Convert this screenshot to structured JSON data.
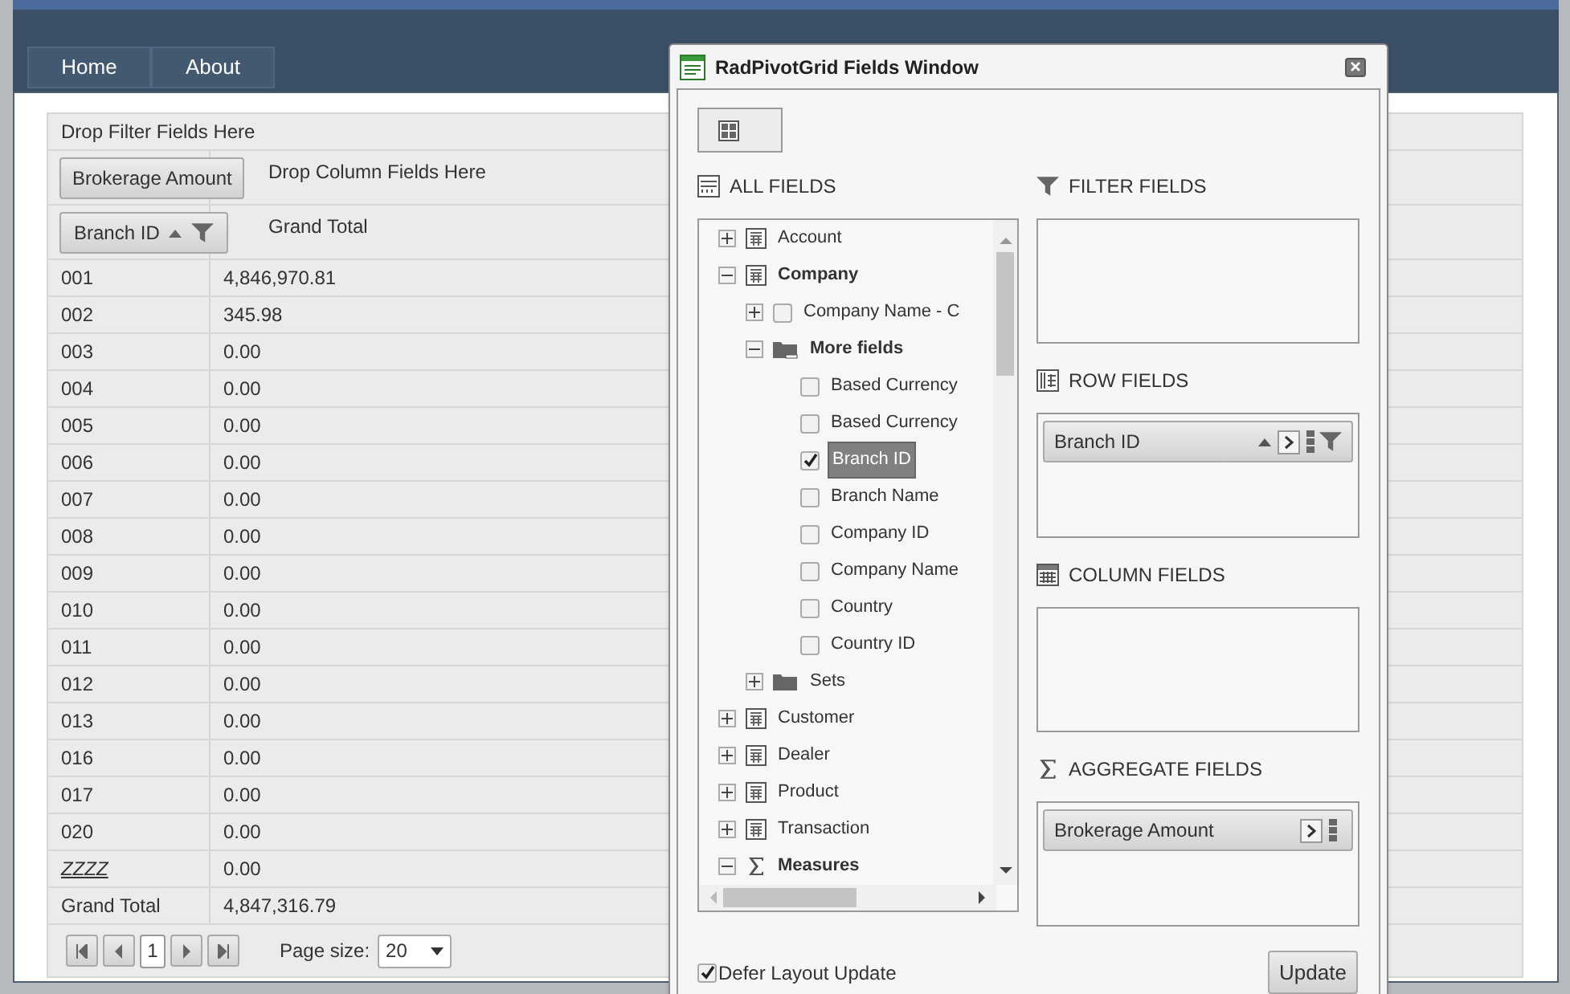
{
  "nav": {
    "tabs": [
      {
        "label": "Home",
        "selected": false
      },
      {
        "label": "About",
        "selected": false
      }
    ]
  },
  "pivot": {
    "filter_zone": "Drop Filter Fields Here",
    "column_zone": "Drop Column Fields Here",
    "aggregate_chip": "Brokerage Amount",
    "row_chip": "Branch ID",
    "column_header": "Grand Total",
    "rows": [
      {
        "label": "001",
        "value": "4,846,970.81",
        "underlined": false
      },
      {
        "label": "002",
        "value": "345.98",
        "underlined": false
      },
      {
        "label": "003",
        "value": "0.00",
        "underlined": false
      },
      {
        "label": "004",
        "value": "0.00",
        "underlined": false
      },
      {
        "label": "005",
        "value": "0.00",
        "underlined": false
      },
      {
        "label": "006",
        "value": "0.00",
        "underlined": false
      },
      {
        "label": "007",
        "value": "0.00",
        "underlined": false
      },
      {
        "label": "008",
        "value": "0.00",
        "underlined": false
      },
      {
        "label": "009",
        "value": "0.00",
        "underlined": false
      },
      {
        "label": "010",
        "value": "0.00",
        "underlined": false
      },
      {
        "label": "011",
        "value": "0.00",
        "underlined": false
      },
      {
        "label": "012",
        "value": "0.00",
        "underlined": false
      },
      {
        "label": "013",
        "value": "0.00",
        "underlined": false
      },
      {
        "label": "016",
        "value": "0.00",
        "underlined": false
      },
      {
        "label": "017",
        "value": "0.00",
        "underlined": false
      },
      {
        "label": "020",
        "value": "0.00",
        "underlined": false
      },
      {
        "label": "ZZZZ",
        "value": "0.00",
        "underlined": true
      }
    ],
    "grand_total": {
      "label": "Grand Total",
      "value": "4,847,316.79"
    },
    "pager": {
      "current_page": "1",
      "page_size_label": "Page size:",
      "page_size": "20"
    }
  },
  "fields_window": {
    "title": "RadPivotGrid Fields Window",
    "all_fields_title": "ALL FIELDS",
    "filter_title": "FILTER FIELDS",
    "row_title": "ROW FIELDS",
    "column_title": "COLUMN FIELDS",
    "aggregate_title": "AGGREGATE FIELDS",
    "tree": [
      {
        "kind": "dimension",
        "label": "Account",
        "expanded": false
      },
      {
        "kind": "dimension",
        "label": "Company",
        "expanded": true,
        "children": [
          {
            "kind": "field",
            "label": "Company Name - C",
            "expanded": false,
            "checked": false,
            "selected": false
          },
          {
            "kind": "folder",
            "label": "More fields",
            "expanded": true,
            "children": [
              {
                "kind": "field",
                "label": "Based Currency",
                "checked": false,
                "selected": false
              },
              {
                "kind": "field",
                "label": "Based Currency",
                "checked": false,
                "selected": false
              },
              {
                "kind": "field",
                "label": "Branch ID",
                "checked": true,
                "selected": true
              },
              {
                "kind": "field",
                "label": "Branch Name",
                "checked": false,
                "selected": false
              },
              {
                "kind": "field",
                "label": "Company ID",
                "checked": false,
                "selected": false
              },
              {
                "kind": "field",
                "label": "Company Name",
                "checked": false,
                "selected": false
              },
              {
                "kind": "field",
                "label": "Country",
                "checked": false,
                "selected": false
              },
              {
                "kind": "field",
                "label": "Country ID",
                "checked": false,
                "selected": false
              }
            ]
          },
          {
            "kind": "folder",
            "label": "Sets",
            "expanded": false
          }
        ]
      },
      {
        "kind": "dimension",
        "label": "Customer",
        "expanded": false
      },
      {
        "kind": "dimension",
        "label": "Dealer",
        "expanded": false
      },
      {
        "kind": "dimension",
        "label": "Product",
        "expanded": false
      },
      {
        "kind": "dimension",
        "label": "Transaction",
        "expanded": false
      },
      {
        "kind": "measures",
        "label": "Measures",
        "expanded": true
      }
    ],
    "row_fields": [
      "Branch ID"
    ],
    "aggregate_fields": [
      "Brokerage Amount"
    ],
    "defer_update": {
      "label": "Defer Layout Update",
      "checked": true
    },
    "update_button": "Update"
  }
}
